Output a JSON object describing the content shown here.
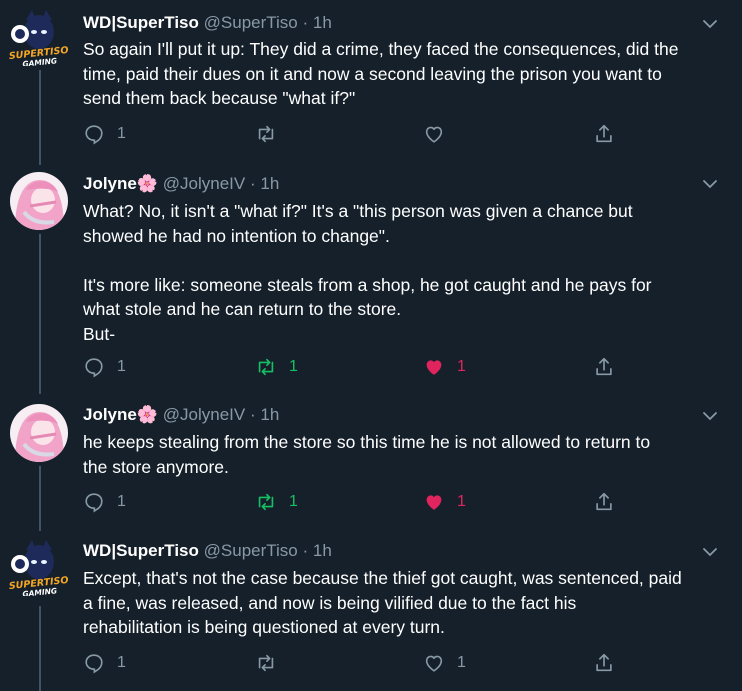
{
  "tweets": [
    {
      "name": "WD|SuperTiso",
      "handle": "@SuperTiso",
      "dot": "·",
      "time": "1h",
      "lines": [
        "So again I'll put it up: They did a crime, they faced the consequences, did the",
        "time, paid their dues on it and now a second leaving the prison you want to",
        "send them back because \"what if?\""
      ],
      "reply_count": "1",
      "retweet_count": "",
      "like_count": "",
      "avatar_text": [
        "SUPERTISO",
        "GAMING"
      ]
    },
    {
      "name": "Jolyne🌸",
      "handle": "@JolyneIV",
      "dot": "·",
      "time": "1h",
      "lines": [
        "What? No, it isn't a \"what if?\" It's a \"this person was given a chance but",
        "showed he had no intention to change\".",
        "",
        "It's more like: someone steals from a shop, he got caught and he pays for",
        "what stole and he can return to the store.",
        "But-"
      ],
      "reply_count": "1",
      "retweet_count": "1",
      "like_count": "1"
    },
    {
      "name": "Jolyne🌸",
      "handle": "@JolyneIV",
      "dot": "·",
      "time": "1h",
      "lines": [
        "he keeps stealing from the store so this time he is not allowed to return to",
        "the store anymore."
      ],
      "reply_count": "1",
      "retweet_count": "1",
      "like_count": "1"
    },
    {
      "name": "WD|SuperTiso",
      "handle": "@SuperTiso",
      "dot": "·",
      "time": "1h",
      "lines": [
        "Except, that's not the case because the thief got caught, was sentenced, paid",
        "a fine, was released, and now is being vilified due to the fact his",
        "rehabilitation is being questioned at every turn."
      ],
      "reply_count": "1",
      "retweet_count": "",
      "like_count": "1",
      "avatar_text": [
        "SUPERTISO",
        "GAMING"
      ]
    }
  ],
  "colors": {
    "background": "#15202b",
    "secondary_text": "#8899a6",
    "retweet_active": "#17bf63",
    "like_active": "#e0245e",
    "thread_line": "#3d5466"
  },
  "icons": [
    "chevron-down-icon",
    "reply-icon",
    "retweet-icon",
    "like-icon",
    "share-icon"
  ]
}
